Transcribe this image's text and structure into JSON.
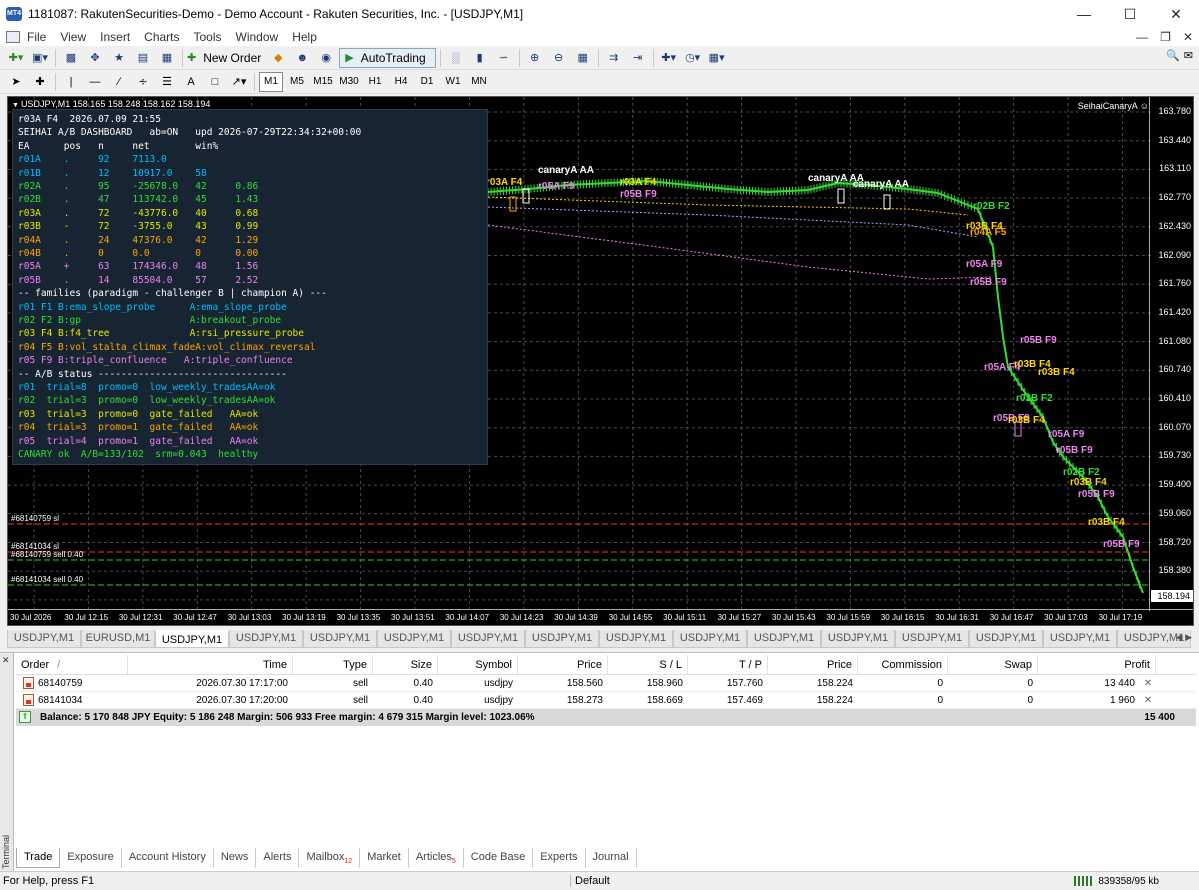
{
  "window": {
    "title": "1181087: RakutenSecurities-Demo - Demo Account - Rakuten Securities, Inc. - [USDJPY,M1]",
    "app_icon_text": "MT4"
  },
  "menu": [
    "File",
    "View",
    "Insert",
    "Charts",
    "Tools",
    "Window",
    "Help"
  ],
  "toolbar": {
    "new_order": "New Order",
    "autotrading": "AutoTrading",
    "timeframes": [
      "M1",
      "M5",
      "M15",
      "M30",
      "H1",
      "H4",
      "D1",
      "W1",
      "MN"
    ],
    "active_timeframe": "M1"
  },
  "chart": {
    "header": "USDJPY,M1  158.165 158.248 158.162 158.194",
    "ea_name": "SeihaiCanaryA",
    "current_price": "158.194",
    "price_labels": [
      "163.780",
      "163.440",
      "163.110",
      "162.770",
      "162.430",
      "162.090",
      "161.760",
      "161.420",
      "161.080",
      "160.740",
      "160.410",
      "160.070",
      "159.730",
      "159.400",
      "159.060",
      "158.720",
      "158.380",
      "158.050"
    ],
    "time_labels": [
      "30 Jul 2026",
      "30 Jul 12:15",
      "30 Jul 12:31",
      "30 Jul 12:47",
      "30 Jul 13:03",
      "30 Jul 13:19",
      "30 Jul 13:35",
      "30 Jul 13:51",
      "30 Jul 14:07",
      "30 Jul 14:23",
      "30 Jul 14:39",
      "30 Jul 14:55",
      "30 Jul 15:11",
      "30 Jul 15:27",
      "30 Jul 15:43",
      "30 Jul 15:59",
      "30 Jul 16:15",
      "30 Jul 16:31",
      "30 Jul 16:47",
      "30 Jul 17:03",
      "30 Jul 17:19"
    ],
    "order_lines": [
      {
        "label": "#68140759 sl",
        "color": "#ff3030"
      },
      {
        "label": "#68141034 sl",
        "color": "#ff3030"
      },
      {
        "label": "#68140759 sell 0.40",
        "color": "#33cc33"
      },
      {
        "label": "#68141034 sell 0.40",
        "color": "#33cc33"
      }
    ],
    "annotations": [
      {
        "text": "r03A F4",
        "color": "#ffd700"
      },
      {
        "text": "r01B F1",
        "color": "#00bfff"
      },
      {
        "text": "r03B F4",
        "color": "#ffd700"
      },
      {
        "text": "r04A F5",
        "color": "#ffa500"
      },
      {
        "text": "r05B F9",
        "color": "#ee82ee"
      },
      {
        "text": "r02B F2",
        "color": "#33dd33"
      },
      {
        "text": "r03B F4",
        "color": "#ffd700"
      },
      {
        "text": "r02B F2",
        "color": "#33dd33"
      },
      {
        "text": "r05B F9",
        "color": "#ee82ee"
      },
      {
        "text": "r05B F9",
        "color": "#ee82ee"
      },
      {
        "text": "r04B F5",
        "color": "#ffa500"
      },
      {
        "text": "r03A F4",
        "color": "#ffd700"
      },
      {
        "text": "canaryA AA",
        "color": "#ffffff"
      },
      {
        "text": "r05A F9",
        "color": "#ee82ee"
      },
      {
        "text": "r03A F4",
        "color": "#ffd700"
      },
      {
        "text": "r05B F9",
        "color": "#ee82ee"
      },
      {
        "text": "canaryA AA",
        "color": "#ffffff"
      },
      {
        "text": "canaryA AA",
        "color": "#ffffff"
      },
      {
        "text": "r02B F2",
        "color": "#33dd33"
      },
      {
        "text": "r03B F4",
        "color": "#ffd700"
      },
      {
        "text": "r04A F5",
        "color": "#ffa500"
      },
      {
        "text": "r05A F9",
        "color": "#ee82ee"
      },
      {
        "text": "r05B F9",
        "color": "#ee82ee"
      },
      {
        "text": "r05B F9",
        "color": "#ee82ee"
      },
      {
        "text": "r05A F4",
        "color": "#ee82ee"
      },
      {
        "text": "r03B F4",
        "color": "#ffd700"
      },
      {
        "text": "r03B F4",
        "color": "#ffd700"
      },
      {
        "text": "r02B F2",
        "color": "#33dd33"
      },
      {
        "text": "r05B F9",
        "color": "#ee82ee"
      },
      {
        "text": "r03B F4",
        "color": "#ffd700"
      },
      {
        "text": "r05A F9",
        "color": "#ee82ee"
      },
      {
        "text": "r05B F9",
        "color": "#ee82ee"
      },
      {
        "text": "r02B F2",
        "color": "#33dd33"
      },
      {
        "text": "r03B F4",
        "color": "#ffd700"
      },
      {
        "text": "r05B F9",
        "color": "#ee82ee"
      },
      {
        "text": "r03B F4",
        "color": "#ffd700"
      },
      {
        "text": "r05B F9",
        "color": "#ee82ee"
      }
    ]
  },
  "dashboard": {
    "lines": [
      {
        "text": "r03A F4  2026.07.09 21:55",
        "color": "#ffffff"
      },
      {
        "text": "SEIHAI A/B DASHBOARD   ab=ON   upd 2026-07-29T22:34:32+00:00",
        "color": "#ffffff"
      },
      {
        "text": "EA      pos   n     net        win%",
        "color": "#ffffff"
      },
      {
        "text": "r01A    .     92    7113.0     ",
        "color": "#00bfff"
      },
      {
        "text": "r01B    .     12    10917.0    58",
        "color": "#00bfff"
      },
      {
        "text": "r02A    .     95    -25678.0   42     0.86",
        "color": "#33dd33"
      },
      {
        "text": "r02B    .     47    113742.0   45     1.43",
        "color": "#33dd33"
      },
      {
        "text": "r03A    .     72    -43776.0   40     0.68",
        "color": "#e6e600"
      },
      {
        "text": "r03B    -     72    -3755.0    43     0.99",
        "color": "#e6e600"
      },
      {
        "text": "r04A    .     24    47376.0    42     1.29",
        "color": "#ffa500"
      },
      {
        "text": "r04B    .     0     0.0        0      0.00",
        "color": "#ffa500"
      },
      {
        "text": "r05A    +     63    174346.0   48     1.56",
        "color": "#ee82ee"
      },
      {
        "text": "r05B    .     14    85504.0    57     2.52",
        "color": "#ee82ee"
      },
      {
        "text": "-- families (paradigm - challenger B | champion A) ---",
        "color": "#ffffff"
      },
      {
        "text": "r01 F1 B:ema_slope_probe      A:ema_slope_probe",
        "color": "#00bfff"
      },
      {
        "text": "r02 F2 B:gp                   A:breakout_probe",
        "color": "#33dd33"
      },
      {
        "text": "r03 F4 B:f4_tree              A:rsi_pressure_probe",
        "color": "#e6e600"
      },
      {
        "text": "r04 F5 B:vol_stalta_climax_fadeA:vol_climax_reversal",
        "color": "#ffa500"
      },
      {
        "text": "r05 F9 B:triple_confluence   A:triple_confluence",
        "color": "#ee82ee"
      },
      {
        "text": "-- A/B status ---------------------------------",
        "color": "#ffffff"
      },
      {
        "text": "r01  trial=8  promo=0  low_weekly_tradesAA=ok",
        "color": "#00bfff"
      },
      {
        "text": "r02  trial=3  promo=0  low_weekly_tradesAA=ok",
        "color": "#33dd33"
      },
      {
        "text": "r03  trial=3  promo=0  gate_failed   AA=ok",
        "color": "#e6e600"
      },
      {
        "text": "r04  trial=3  promo=1  gate_failed   AA=ok",
        "color": "#ffa500"
      },
      {
        "text": "r05  trial=4  promo=1  gate_failed   AA=ok",
        "color": "#ee82ee"
      },
      {
        "text": "CANARY ok  A/B=133/102  srm=0.043  healthy",
        "color": "#33dd33"
      }
    ]
  },
  "chart_tabs": [
    "USDJPY,M1",
    "EURUSD,M1",
    "USDJPY,M1",
    "USDJPY,M1",
    "USDJPY,M1",
    "USDJPY,M1",
    "USDJPY,M1",
    "USDJPY,M1",
    "USDJPY,M1",
    "USDJPY,M1",
    "USDJPY,M1",
    "USDJPY,M1",
    "USDJPY,M1",
    "USDJPY,M1",
    "USDJPY,M1",
    "USDJPY,M1"
  ],
  "active_chart_tab": 2,
  "terminal": {
    "side_label": "Terminal",
    "columns": [
      "Order",
      "Time",
      "Type",
      "Size",
      "Symbol",
      "Price",
      "S / L",
      "T / P",
      "Price",
      "Commission",
      "Swap",
      "Profit"
    ],
    "sort_indicator": "/",
    "orders": [
      {
        "order": "68140759",
        "time": "2026.07.30 17:17:00",
        "type": "sell",
        "size": "0.40",
        "symbol": "usdjpy",
        "price": "158.560",
        "sl": "158.960",
        "tp": "157.760",
        "cur_price": "158.224",
        "commission": "0",
        "swap": "0",
        "profit": "13 440"
      },
      {
        "order": "68141034",
        "time": "2026.07.30 17:20:00",
        "type": "sell",
        "size": "0.40",
        "symbol": "usdjpy",
        "price": "158.273",
        "sl": "158.669",
        "tp": "157.469",
        "cur_price": "158.224",
        "commission": "0",
        "swap": "0",
        "profit": "1 960"
      }
    ],
    "balance_text": "Balance: 5 170 848 JPY  Equity: 5 186 248  Margin: 506 933  Free margin: 4 679 315  Margin level: 1023.06%",
    "balance_profit": "15 400",
    "tabs": [
      {
        "label": "Trade",
        "badge": ""
      },
      {
        "label": "Exposure",
        "badge": ""
      },
      {
        "label": "Account History",
        "badge": ""
      },
      {
        "label": "News",
        "badge": ""
      },
      {
        "label": "Alerts",
        "badge": ""
      },
      {
        "label": "Mailbox",
        "badge": "12"
      },
      {
        "label": "Market",
        "badge": ""
      },
      {
        "label": "Articles",
        "badge": "5"
      },
      {
        "label": "Code Base",
        "badge": ""
      },
      {
        "label": "Experts",
        "badge": ""
      },
      {
        "label": "Journal",
        "badge": ""
      }
    ],
    "active_tab": 0
  },
  "status": {
    "help": "For Help, press F1",
    "profile": "Default",
    "traffic": "839358/95 kb"
  }
}
